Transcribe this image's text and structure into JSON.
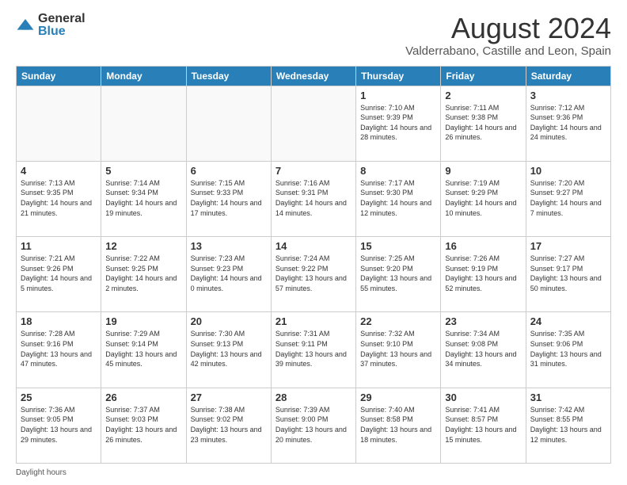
{
  "logo": {
    "general": "General",
    "blue": "Blue"
  },
  "title": "August 2024",
  "subtitle": "Valderrabano, Castille and Leon, Spain",
  "days_header": [
    "Sunday",
    "Monday",
    "Tuesday",
    "Wednesday",
    "Thursday",
    "Friday",
    "Saturday"
  ],
  "weeks": [
    [
      {
        "day": "",
        "info": ""
      },
      {
        "day": "",
        "info": ""
      },
      {
        "day": "",
        "info": ""
      },
      {
        "day": "",
        "info": ""
      },
      {
        "day": "1",
        "info": "Sunrise: 7:10 AM\nSunset: 9:39 PM\nDaylight: 14 hours\nand 28 minutes."
      },
      {
        "day": "2",
        "info": "Sunrise: 7:11 AM\nSunset: 9:38 PM\nDaylight: 14 hours\nand 26 minutes."
      },
      {
        "day": "3",
        "info": "Sunrise: 7:12 AM\nSunset: 9:36 PM\nDaylight: 14 hours\nand 24 minutes."
      }
    ],
    [
      {
        "day": "4",
        "info": "Sunrise: 7:13 AM\nSunset: 9:35 PM\nDaylight: 14 hours\nand 21 minutes."
      },
      {
        "day": "5",
        "info": "Sunrise: 7:14 AM\nSunset: 9:34 PM\nDaylight: 14 hours\nand 19 minutes."
      },
      {
        "day": "6",
        "info": "Sunrise: 7:15 AM\nSunset: 9:33 PM\nDaylight: 14 hours\nand 17 minutes."
      },
      {
        "day": "7",
        "info": "Sunrise: 7:16 AM\nSunset: 9:31 PM\nDaylight: 14 hours\nand 14 minutes."
      },
      {
        "day": "8",
        "info": "Sunrise: 7:17 AM\nSunset: 9:30 PM\nDaylight: 14 hours\nand 12 minutes."
      },
      {
        "day": "9",
        "info": "Sunrise: 7:19 AM\nSunset: 9:29 PM\nDaylight: 14 hours\nand 10 minutes."
      },
      {
        "day": "10",
        "info": "Sunrise: 7:20 AM\nSunset: 9:27 PM\nDaylight: 14 hours\nand 7 minutes."
      }
    ],
    [
      {
        "day": "11",
        "info": "Sunrise: 7:21 AM\nSunset: 9:26 PM\nDaylight: 14 hours\nand 5 minutes."
      },
      {
        "day": "12",
        "info": "Sunrise: 7:22 AM\nSunset: 9:25 PM\nDaylight: 14 hours\nand 2 minutes."
      },
      {
        "day": "13",
        "info": "Sunrise: 7:23 AM\nSunset: 9:23 PM\nDaylight: 14 hours\nand 0 minutes."
      },
      {
        "day": "14",
        "info": "Sunrise: 7:24 AM\nSunset: 9:22 PM\nDaylight: 13 hours\nand 57 minutes."
      },
      {
        "day": "15",
        "info": "Sunrise: 7:25 AM\nSunset: 9:20 PM\nDaylight: 13 hours\nand 55 minutes."
      },
      {
        "day": "16",
        "info": "Sunrise: 7:26 AM\nSunset: 9:19 PM\nDaylight: 13 hours\nand 52 minutes."
      },
      {
        "day": "17",
        "info": "Sunrise: 7:27 AM\nSunset: 9:17 PM\nDaylight: 13 hours\nand 50 minutes."
      }
    ],
    [
      {
        "day": "18",
        "info": "Sunrise: 7:28 AM\nSunset: 9:16 PM\nDaylight: 13 hours\nand 47 minutes."
      },
      {
        "day": "19",
        "info": "Sunrise: 7:29 AM\nSunset: 9:14 PM\nDaylight: 13 hours\nand 45 minutes."
      },
      {
        "day": "20",
        "info": "Sunrise: 7:30 AM\nSunset: 9:13 PM\nDaylight: 13 hours\nand 42 minutes."
      },
      {
        "day": "21",
        "info": "Sunrise: 7:31 AM\nSunset: 9:11 PM\nDaylight: 13 hours\nand 39 minutes."
      },
      {
        "day": "22",
        "info": "Sunrise: 7:32 AM\nSunset: 9:10 PM\nDaylight: 13 hours\nand 37 minutes."
      },
      {
        "day": "23",
        "info": "Sunrise: 7:34 AM\nSunset: 9:08 PM\nDaylight: 13 hours\nand 34 minutes."
      },
      {
        "day": "24",
        "info": "Sunrise: 7:35 AM\nSunset: 9:06 PM\nDaylight: 13 hours\nand 31 minutes."
      }
    ],
    [
      {
        "day": "25",
        "info": "Sunrise: 7:36 AM\nSunset: 9:05 PM\nDaylight: 13 hours\nand 29 minutes."
      },
      {
        "day": "26",
        "info": "Sunrise: 7:37 AM\nSunset: 9:03 PM\nDaylight: 13 hours\nand 26 minutes."
      },
      {
        "day": "27",
        "info": "Sunrise: 7:38 AM\nSunset: 9:02 PM\nDaylight: 13 hours\nand 23 minutes."
      },
      {
        "day": "28",
        "info": "Sunrise: 7:39 AM\nSunset: 9:00 PM\nDaylight: 13 hours\nand 20 minutes."
      },
      {
        "day": "29",
        "info": "Sunrise: 7:40 AM\nSunset: 8:58 PM\nDaylight: 13 hours\nand 18 minutes."
      },
      {
        "day": "30",
        "info": "Sunrise: 7:41 AM\nSunset: 8:57 PM\nDaylight: 13 hours\nand 15 minutes."
      },
      {
        "day": "31",
        "info": "Sunrise: 7:42 AM\nSunset: 8:55 PM\nDaylight: 13 hours\nand 12 minutes."
      }
    ]
  ],
  "footer": "Daylight hours"
}
